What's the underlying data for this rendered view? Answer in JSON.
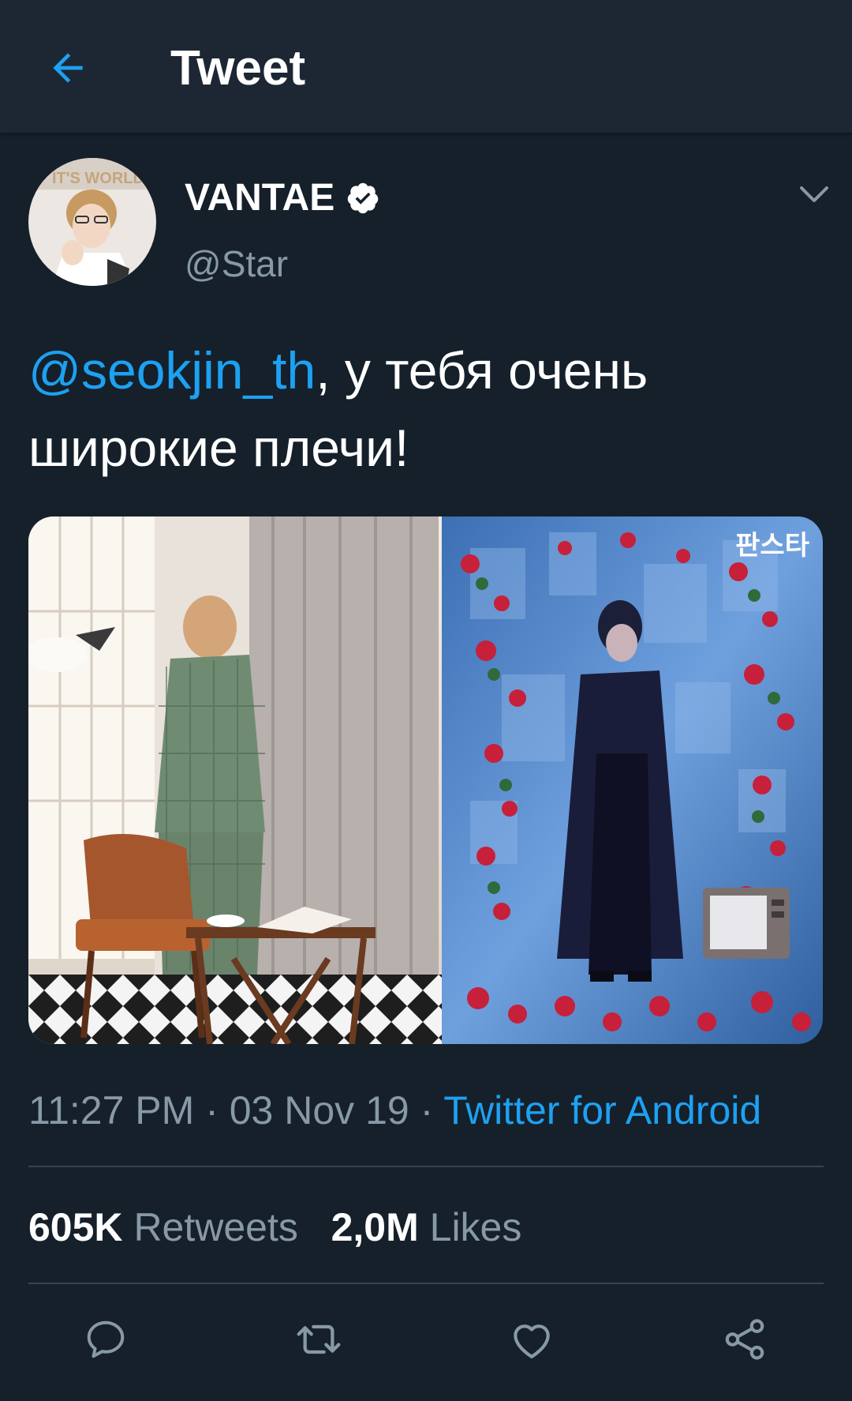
{
  "header": {
    "title": "Tweet",
    "back_icon": "arrow-left-icon"
  },
  "tweet": {
    "author": {
      "name": "VANTAE",
      "handle": "@Star",
      "verified": true,
      "avatar_text": "IT'S WORLD"
    },
    "text": {
      "mention": "@seokjin_th",
      "body": ", у тебя очень широкие плечи!"
    },
    "media": {
      "watermark": "판스타"
    },
    "meta": {
      "time": "11:27 PM",
      "separator": " · ",
      "date": "03 Nov 19",
      "separator2": " · ",
      "source": "Twitter for Android"
    },
    "stats": {
      "retweets_count": "605K",
      "retweets_label": "Retweets",
      "likes_count": "2,0M",
      "likes_label": "Likes"
    }
  },
  "actions": [
    "reply-icon",
    "retweet-icon",
    "like-icon",
    "share-icon"
  ],
  "colors": {
    "background": "#15202b",
    "header": "#1c2733",
    "accent": "#1da1f2",
    "secondary_text": "#8899a6",
    "divider": "#38444d"
  }
}
